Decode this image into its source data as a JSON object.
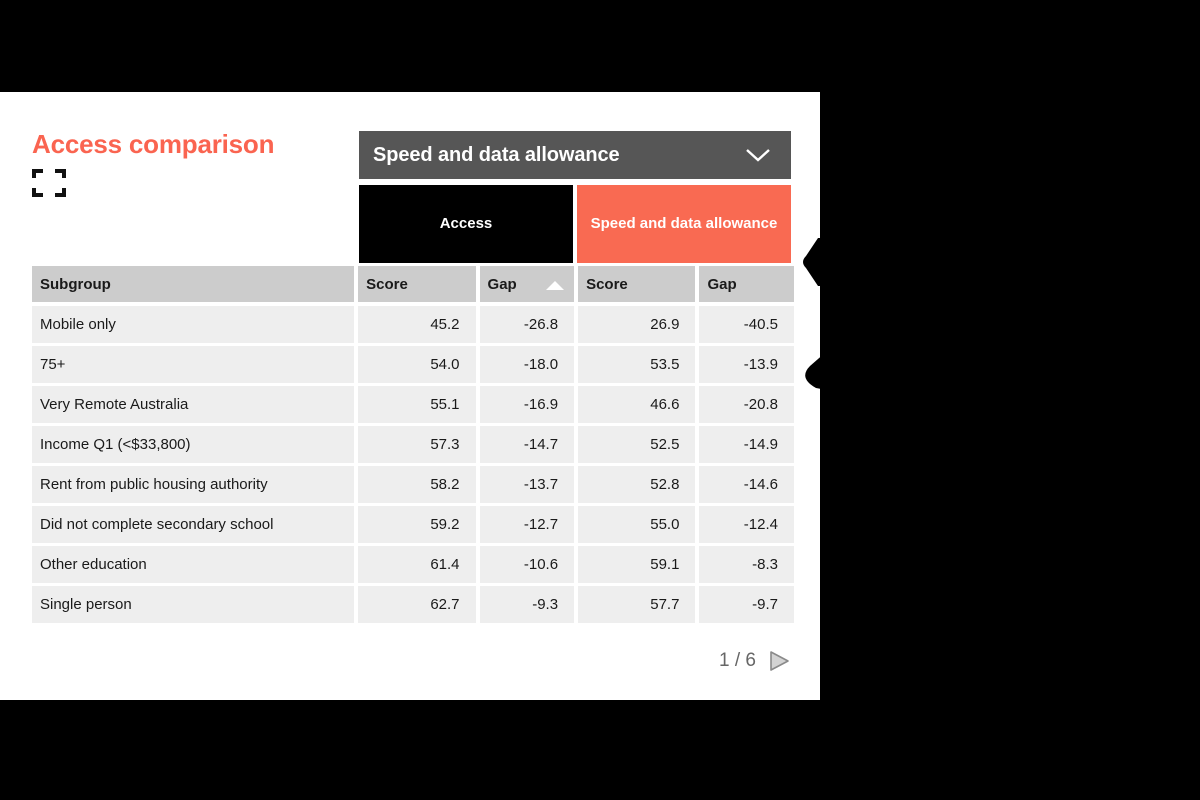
{
  "widget": {
    "title": "Access comparison",
    "expand_icon": "fullscreen-icon",
    "accent_color": "#fa6450",
    "dropdown_bar_color": "#565656",
    "header_row_color": "#cccccc",
    "row_color": "#eeeeee"
  },
  "selector": {
    "value": "Speed and data allowance",
    "chevron": "chevron-down-icon"
  },
  "tabs": [
    {
      "label": "Access",
      "color": "#000000",
      "active": false
    },
    {
      "label": "Speed and data allowance",
      "color": "#f96a52",
      "active": true
    }
  ],
  "table": {
    "columns": [
      {
        "label": "Subgroup",
        "sorted": false
      },
      {
        "label": "Score",
        "sorted": false
      },
      {
        "label": "Gap",
        "sorted": true,
        "sort_direction": "ascending"
      },
      {
        "label": "Score",
        "sorted": false
      },
      {
        "label": "Gap",
        "sorted": false
      }
    ],
    "rows": [
      {
        "subgroup": "Mobile only",
        "access_score": "45.2",
        "access_gap": "-26.8",
        "speed_score": "26.9",
        "speed_gap": "-40.5"
      },
      {
        "subgroup": "75+",
        "access_score": "54.0",
        "access_gap": "-18.0",
        "speed_score": "53.5",
        "speed_gap": "-13.9"
      },
      {
        "subgroup": "Very Remote Australia",
        "access_score": "55.1",
        "access_gap": "-16.9",
        "speed_score": "46.6",
        "speed_gap": "-20.8"
      },
      {
        "subgroup": "Income Q1 (<$33,800)",
        "access_score": "57.3",
        "access_gap": "-14.7",
        "speed_score": "52.5",
        "speed_gap": "-14.9"
      },
      {
        "subgroup": "Rent from public housing authority",
        "access_score": "58.2",
        "access_gap": "-13.7",
        "speed_score": "52.8",
        "speed_gap": "-14.6"
      },
      {
        "subgroup": "Did not complete secondary school",
        "access_score": "59.2",
        "access_gap": "-12.7",
        "speed_score": "55.0",
        "speed_gap": "-12.4"
      },
      {
        "subgroup": "Other education",
        "access_score": "61.4",
        "access_gap": "-10.6",
        "speed_score": "59.1",
        "speed_gap": "-8.3"
      },
      {
        "subgroup": "Single person",
        "access_score": "62.7",
        "access_gap": "-9.3",
        "speed_score": "57.7",
        "speed_gap": "-9.7"
      }
    ]
  },
  "pager": {
    "text": "1 / 6",
    "next_icon": "play-next-icon"
  }
}
